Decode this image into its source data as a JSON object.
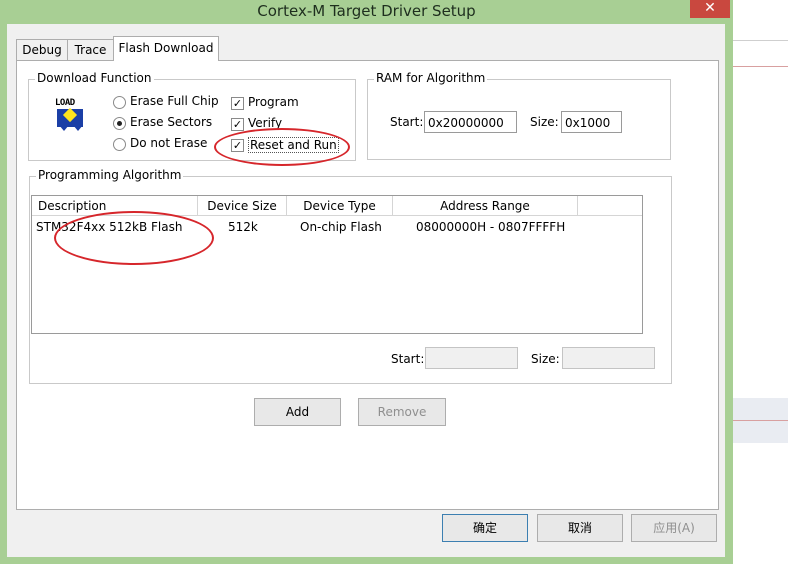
{
  "window": {
    "title": "Cortex-M Target Driver Setup",
    "close_glyph": "✕"
  },
  "tabs": [
    {
      "label": "Debug"
    },
    {
      "label": "Trace"
    },
    {
      "label": "Flash Download"
    }
  ],
  "download_function": {
    "title": "Download Function",
    "icon_text": "LOAD",
    "erase_options": [
      {
        "label": "Erase Full Chip",
        "selected": false
      },
      {
        "label": "Erase Sectors",
        "selected": true
      },
      {
        "label": "Do not Erase",
        "selected": false
      }
    ],
    "checks": [
      {
        "label": "Program",
        "checked": true
      },
      {
        "label": "Verify",
        "checked": true
      },
      {
        "label": "Reset and Run",
        "checked": true
      }
    ]
  },
  "ram": {
    "title": "RAM for Algorithm",
    "start_label": "Start:",
    "start_value": "0x20000000",
    "size_label": "Size:",
    "size_value": "0x1000"
  },
  "programming": {
    "title": "Programming Algorithm",
    "columns": [
      "Description",
      "Device Size",
      "Device Type",
      "Address Range"
    ],
    "rows": [
      {
        "description": "STM32F4xx 512kB Flash",
        "size": "512k",
        "type": "On-chip Flash",
        "range": "08000000H - 0807FFFFH"
      }
    ],
    "start_label": "Start:",
    "start_value": "",
    "size_label": "Size:",
    "size_value": ""
  },
  "buttons": {
    "add": "Add",
    "remove": "Remove",
    "ok": "确定",
    "cancel": "取消",
    "apply": "应用(A)"
  },
  "colors": {
    "titlebar": "#a8cf94",
    "annotation": "#d6262b",
    "close": "#c9483f"
  }
}
